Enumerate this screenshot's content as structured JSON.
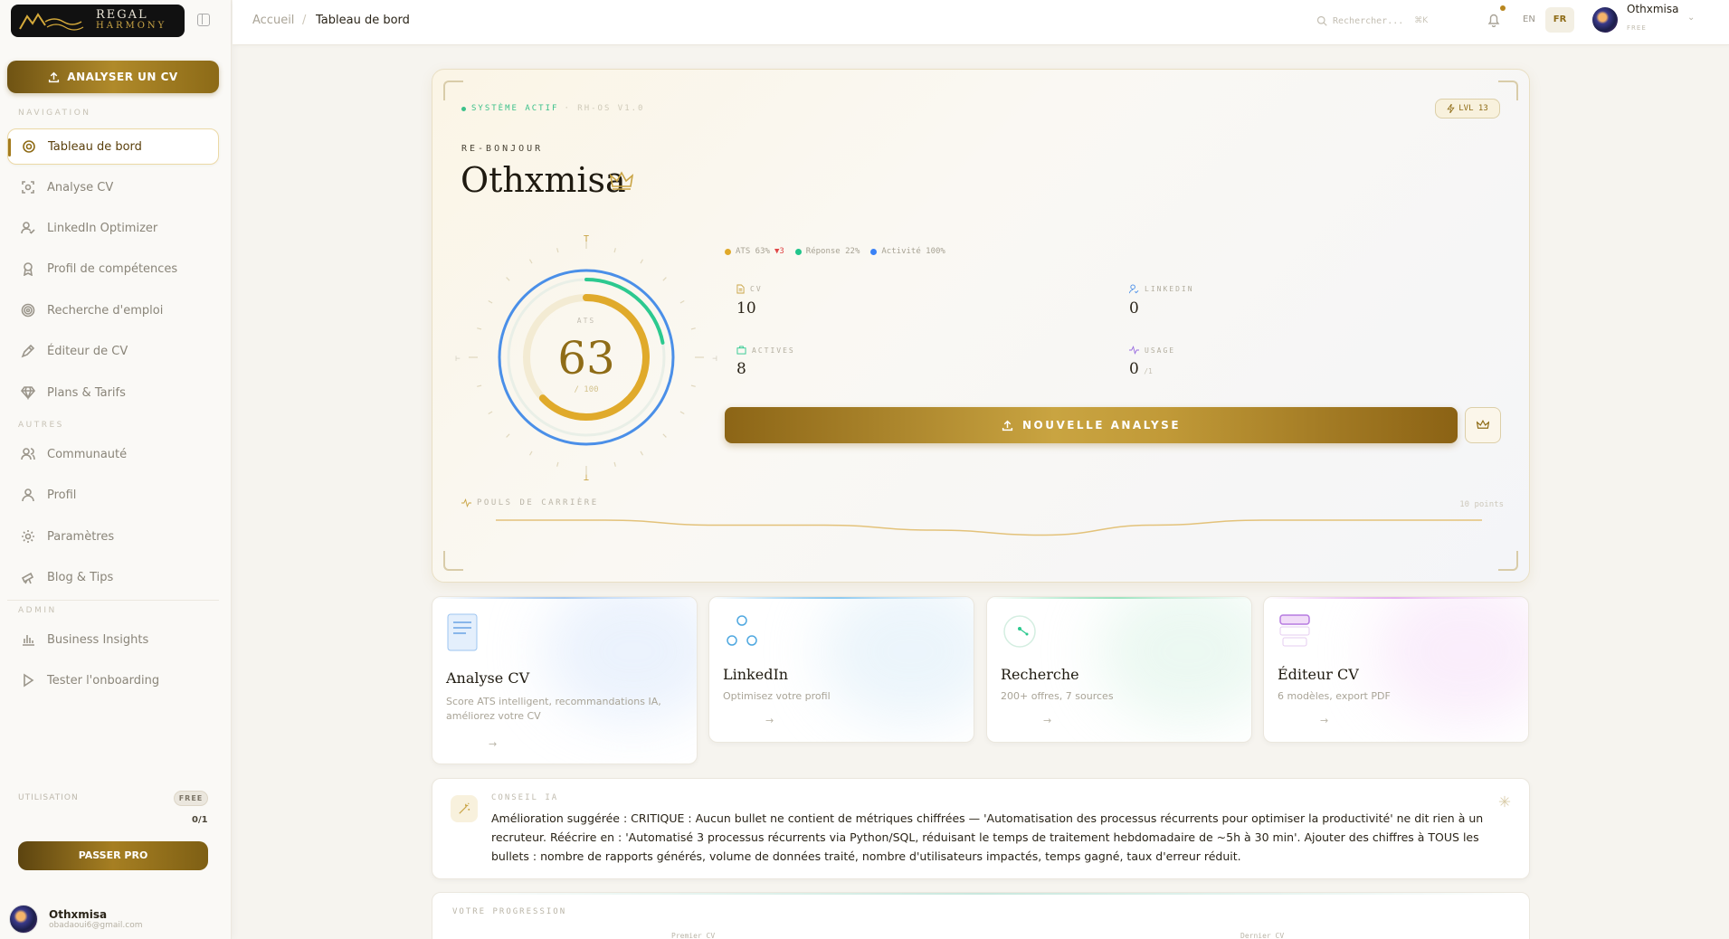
{
  "brand": {
    "line1": "REGAL",
    "line2": "HARMONY"
  },
  "sidebar": {
    "cta_label": "ANALYSER UN CV",
    "section_nav": "NAVIGATION",
    "section_other": "AUTRES",
    "section_admin": "ADMIN",
    "nav": [
      {
        "label": "Tableau de bord",
        "icon": "dashboard-icon"
      },
      {
        "label": "Analyse CV",
        "icon": "scan-icon"
      },
      {
        "label": "LinkedIn Optimizer",
        "icon": "user-check-icon"
      },
      {
        "label": "Profil de compétences",
        "icon": "award-icon"
      },
      {
        "label": "Recherche d'emploi",
        "icon": "target-icon"
      },
      {
        "label": "Éditeur de CV",
        "icon": "pen-icon"
      },
      {
        "label": "Plans & Tarifs",
        "icon": "gem-icon"
      }
    ],
    "other": [
      {
        "label": "Communauté",
        "icon": "users-icon"
      },
      {
        "label": "Profil",
        "icon": "user-icon"
      },
      {
        "label": "Paramètres",
        "icon": "gear-icon"
      },
      {
        "label": "Blog & Tips",
        "icon": "telescope-icon"
      }
    ],
    "admin": [
      {
        "label": "Business Insights",
        "icon": "bar-chart-icon"
      },
      {
        "label": "Tester l'onboarding",
        "icon": "play-icon"
      }
    ],
    "usage_label": "UTILISATION",
    "plan_badge": "FREE",
    "usage_count": "0/1",
    "pro_label": "PASSER PRO",
    "user_name": "Othxmisa",
    "user_email": "obadaoui6@gmail.com"
  },
  "topbar": {
    "crumb_home": "Accueil",
    "crumb_sep": "/",
    "crumb_current": "Tableau de bord",
    "search_placeholder": "Rechercher...",
    "search_kbd": "⌘K",
    "lang_en": "EN",
    "lang_fr": "FR",
    "user_name": "Othxmisa",
    "user_plan": "FREE"
  },
  "hero": {
    "status": "SYSTÈME ACTIF",
    "version": "· RH-OS V1.0",
    "level": "LVL 13",
    "greeting": "RE-BONJOUR",
    "name": "Othxmisa",
    "gauge_label": "ATS",
    "gauge_value": "63",
    "gauge_max": "/ 100",
    "gauge_score": 63,
    "gauge_scale_top": "T",
    "gauge_scale_bottom": "⊥",
    "gauge_scale_left": "⊢",
    "gauge_scale_right": "⊣",
    "legend": [
      {
        "label": "ATS 63%",
        "delta": "▼3",
        "color": "#e0a92a"
      },
      {
        "label": "Réponse 22%",
        "delta": "",
        "color": "#21c58b"
      },
      {
        "label": "Activité 100%",
        "delta": "",
        "color": "#3b82f6"
      }
    ],
    "stats": {
      "cv": {
        "label": "CV",
        "value": "10"
      },
      "linkedin": {
        "label": "LINKEDIN",
        "value": "0"
      },
      "actives": {
        "label": "ACTIVES",
        "value": "8"
      },
      "usage": {
        "label": "USAGE",
        "value": "0",
        "suffix": "/1"
      }
    },
    "new_analysis": "NOUVELLE ANALYSE",
    "pulse_label": "POULS DE CARRIÈRE",
    "pulse_points": "10 points",
    "pulse_values": [
      6,
      6,
      5,
      5,
      4,
      3,
      5,
      6,
      6,
      6
    ]
  },
  "cards": [
    {
      "title": "Analyse CV",
      "desc": "Score ATS intelligent, recommandations IA, améliorez votre CV",
      "arrow": "→",
      "icon": "document-icon",
      "accent": "#9cc4f0"
    },
    {
      "title": "LinkedIn",
      "desc": "Optimisez votre profil",
      "arrow": "→",
      "icon": "network-icon",
      "accent": "#7cc3ef"
    },
    {
      "title": "Recherche",
      "desc": "200+ offres, 7 sources",
      "arrow": "→",
      "icon": "radar-icon",
      "accent": "#8ee0b8"
    },
    {
      "title": "Éditeur CV",
      "desc": "6 modèles, export PDF",
      "arrow": "→",
      "icon": "layers-icon",
      "accent": "#e3a8f0"
    }
  ],
  "advice": {
    "label": "CONSEIL IA",
    "text": "Amélioration suggérée : CRITIQUE : Aucun bullet ne contient de métriques chiffrées — 'Automatisation des processus récurrents pour optimiser la productivité' ne dit rien à un recruteur. Réécrire en : 'Automatisé 3 processus récurrents via Python/SQL, réduisant le temps de traitement hebdomadaire de ~5h à 30 min'. Ajouter des chiffres à TOUS les bullets : nombre de rapports générés, volume de données traité, nombre d'utilisateurs impactés, temps gagné, taux d'erreur réduit."
  },
  "progress": {
    "label": "VOTRE PROGRESSION",
    "first": "Premier CV",
    "last": "Dernier CV"
  },
  "colors": {
    "gold": "#a47c1e",
    "green": "#21c58b",
    "blue": "#3b82f6"
  }
}
